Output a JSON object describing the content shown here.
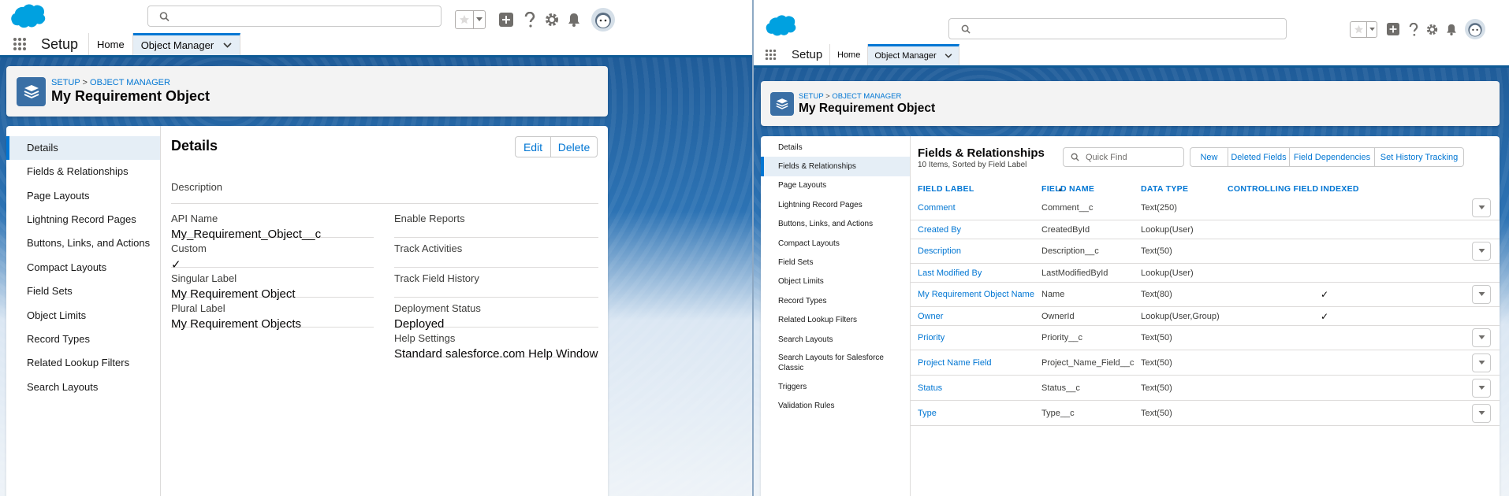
{
  "common": {
    "app_name": "Setup",
    "tabs": [
      {
        "label": "Home"
      },
      {
        "label": "Object Manager"
      }
    ],
    "breadcrumb": {
      "setup": "SETUP",
      "sep": ">",
      "object_manager": "OBJECT MANAGER"
    },
    "object_title": "My Requirement Object",
    "colors": {
      "brand_blue": "#0176d3",
      "logo_blue": "#00a1e0",
      "icon_bg": "#3a6fa5",
      "dark_band": "#0e5a95"
    },
    "icons": [
      "salesforce-cloud-logo",
      "search-icon",
      "star-icon",
      "chevron-down-icon",
      "plus-icon",
      "help-icon",
      "gear-icon",
      "bell-icon",
      "avatar",
      "waffle-icon",
      "layers-icon"
    ]
  },
  "left": {
    "nav": [
      {
        "label": "Details",
        "active": true
      },
      {
        "label": "Fields & Relationships"
      },
      {
        "label": "Page Layouts"
      },
      {
        "label": "Lightning Record Pages"
      },
      {
        "label": "Buttons, Links, and Actions"
      },
      {
        "label": "Compact Layouts"
      },
      {
        "label": "Field Sets"
      },
      {
        "label": "Object Limits"
      },
      {
        "label": "Record Types"
      },
      {
        "label": "Related Lookup Filters"
      },
      {
        "label": "Search Layouts"
      }
    ],
    "details": {
      "title": "Details",
      "edit_label": "Edit",
      "delete_label": "Delete",
      "description_label": "Description",
      "description_value": "",
      "api_name_label": "API Name",
      "api_name_value": "My_Requirement_Object__c",
      "custom_label": "Custom",
      "custom_value": "✓",
      "singular_label": "Singular Label",
      "singular_value": "My Requirement Object",
      "plural_label": "Plural Label",
      "plural_value": "My Requirement Objects",
      "enable_reports_label": "Enable Reports",
      "enable_reports_value": "",
      "track_activities_label": "Track Activities",
      "track_activities_value": "",
      "track_history_label": "Track Field History",
      "track_history_value": "",
      "deployment_label": "Deployment Status",
      "deployment_value": "Deployed",
      "help_label": "Help Settings",
      "help_value": "Standard salesforce.com Help Window"
    }
  },
  "right": {
    "nav": [
      {
        "label": "Details"
      },
      {
        "label": "Fields & Relationships",
        "active": true
      },
      {
        "label": "Page Layouts"
      },
      {
        "label": "Lightning Record Pages"
      },
      {
        "label": "Buttons, Links, and Actions"
      },
      {
        "label": "Compact Layouts"
      },
      {
        "label": "Field Sets"
      },
      {
        "label": "Object Limits"
      },
      {
        "label": "Record Types"
      },
      {
        "label": "Related Lookup Filters"
      },
      {
        "label": "Search Layouts"
      },
      {
        "label": "Search Layouts for Salesforce Classic"
      },
      {
        "label": "Triggers"
      },
      {
        "label": "Validation Rules"
      }
    ],
    "fields": {
      "title": "Fields & Relationships",
      "subtitle": "10 Items, Sorted by Field Label",
      "quick_find_placeholder": "Quick Find",
      "buttons": [
        "New",
        "Deleted Fields",
        "Field Dependencies",
        "Set History Tracking"
      ],
      "columns": [
        "FIELD LABEL",
        "FIELD NAME",
        "DATA TYPE",
        "CONTROLLING FIELD",
        "INDEXED"
      ],
      "sort_indicator": "▲",
      "rows": [
        {
          "label": "Comment",
          "name": "Comment__c",
          "type": "Text(250)",
          "controlling": "",
          "indexed": "",
          "action": true
        },
        {
          "label": "Created By",
          "name": "CreatedById",
          "type": "Lookup(User)",
          "controlling": "",
          "indexed": "",
          "action": false
        },
        {
          "label": "Description",
          "name": "Description__c",
          "type": "Text(50)",
          "controlling": "",
          "indexed": "",
          "action": true
        },
        {
          "label": "Last Modified By",
          "name": "LastModifiedById",
          "type": "Lookup(User)",
          "controlling": "",
          "indexed": "",
          "action": false
        },
        {
          "label": "My Requirement Object Name",
          "name": "Name",
          "type": "Text(80)",
          "controlling": "",
          "indexed": "✓",
          "action": true
        },
        {
          "label": "Owner",
          "name": "OwnerId",
          "type": "Lookup(User,Group)",
          "controlling": "",
          "indexed": "✓",
          "action": false
        },
        {
          "label": "Priority",
          "name": "Priority__c",
          "type": "Text(50)",
          "controlling": "",
          "indexed": "",
          "action": true
        },
        {
          "label": "Project Name Field",
          "name": "Project_Name_Field__c",
          "type": "Text(50)",
          "controlling": "",
          "indexed": "",
          "action": true
        },
        {
          "label": "Status",
          "name": "Status__c",
          "type": "Text(50)",
          "controlling": "",
          "indexed": "",
          "action": true
        },
        {
          "label": "Type",
          "name": "Type__c",
          "type": "Text(50)",
          "controlling": "",
          "indexed": "",
          "action": true
        }
      ]
    }
  }
}
